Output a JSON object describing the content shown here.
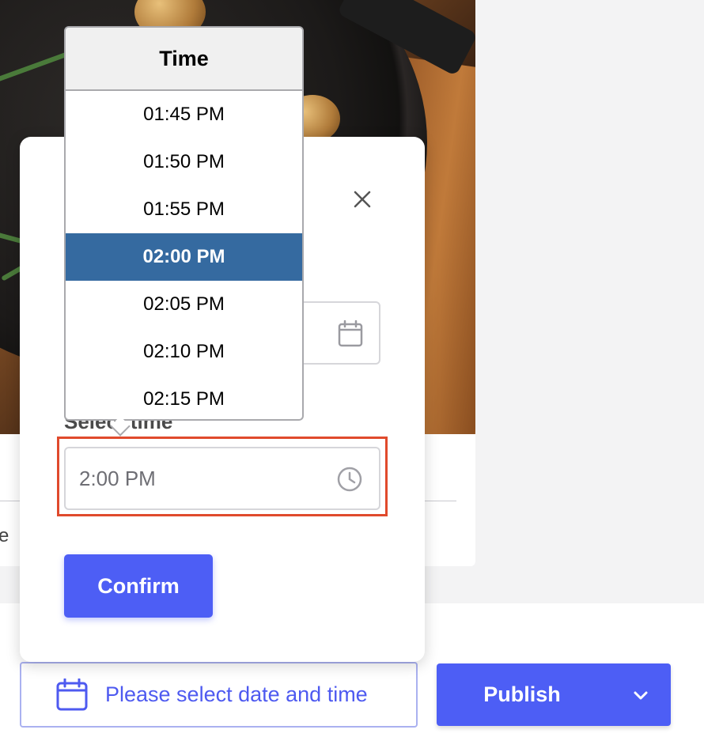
{
  "background": {
    "fragment_text": "e"
  },
  "modal": {
    "time_label": "Select time",
    "time_value": "2:00 PM",
    "confirm_label": "Confirm",
    "icons": [
      "close-icon",
      "calendar-icon",
      "clock-icon"
    ]
  },
  "time_picker": {
    "header": "Time",
    "options": [
      "01:45 PM",
      "01:50 PM",
      "01:55 PM",
      "02:00 PM",
      "02:05 PM",
      "02:10 PM",
      "02:15 PM"
    ],
    "selected": "02:00 PM"
  },
  "bottom_bar": {
    "schedule_label": "Please select date and time",
    "publish_label": "Publish",
    "icons": [
      "calendar-icon",
      "chevron-down-icon"
    ]
  },
  "colors": {
    "accent": "#4d5ef5",
    "selected_option": "#356aa0",
    "highlight_border": "#e04a2c"
  }
}
